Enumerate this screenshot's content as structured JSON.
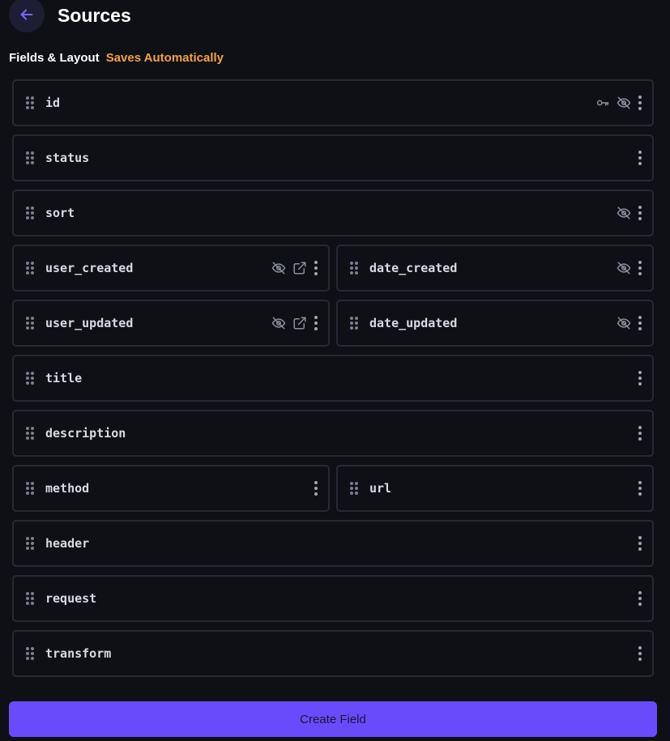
{
  "header": {
    "back_icon": "arrow-left-icon",
    "title": "Sources"
  },
  "subheader": {
    "label": "Fields & Layout",
    "status": "Saves Automatically"
  },
  "colors": {
    "accent": "#6a4bfb",
    "status": "#f2a241",
    "background": "#0f1016",
    "card_border": "#262934"
  },
  "fields": [
    {
      "name": "id",
      "icons": [
        "key-icon",
        "eye-off-icon"
      ]
    },
    {
      "name": "status",
      "icons": []
    },
    {
      "name": "sort",
      "icons": [
        "eye-off-icon"
      ]
    },
    {
      "name": "user_created",
      "icons": [
        "eye-off-icon",
        "external-link-icon"
      ]
    },
    {
      "name": "date_created",
      "icons": [
        "eye-off-icon"
      ]
    },
    {
      "name": "user_updated",
      "icons": [
        "eye-off-icon",
        "external-link-icon"
      ]
    },
    {
      "name": "date_updated",
      "icons": [
        "eye-off-icon"
      ]
    },
    {
      "name": "title",
      "icons": []
    },
    {
      "name": "description",
      "icons": []
    },
    {
      "name": "method",
      "icons": []
    },
    {
      "name": "url",
      "icons": []
    },
    {
      "name": "header",
      "icons": []
    },
    {
      "name": "request",
      "icons": []
    },
    {
      "name": "transform",
      "icons": []
    }
  ],
  "create_button": {
    "label": "Create Field"
  }
}
